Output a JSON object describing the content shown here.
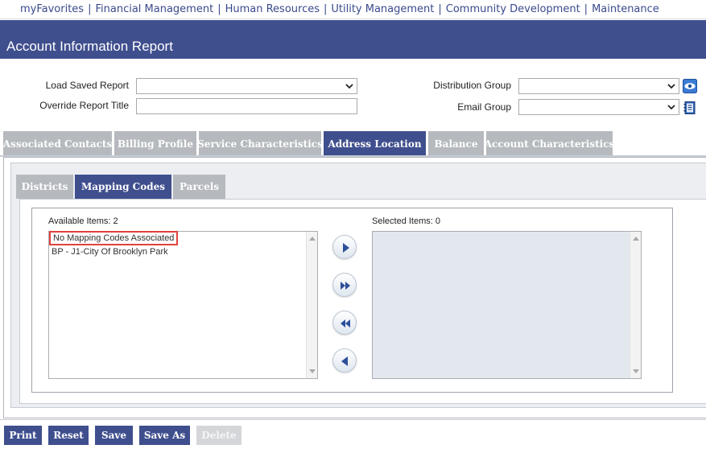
{
  "nav": {
    "items": [
      "myFavorites",
      "Financial Management",
      "Human Resources",
      "Utility Management",
      "Community Development",
      "Maintenance"
    ],
    "separator": "|"
  },
  "header": {
    "title": "Account Information Report"
  },
  "form": {
    "load_saved_report_label": "Load Saved Report",
    "load_saved_report_value": "",
    "override_title_label": "Override Report Title",
    "override_title_value": "",
    "distribution_group_label": "Distribution Group",
    "distribution_group_value": "",
    "email_group_label": "Email Group",
    "email_group_value": ""
  },
  "main_tabs": [
    "Associated Contacts",
    "Billing Profile",
    "Service Characteristics",
    "Address Location",
    "Balance",
    "Account Characteristics"
  ],
  "main_tab_active": "Address Location",
  "sub_tabs": [
    "Districts",
    "Mapping Codes",
    "Parcels"
  ],
  "sub_tab_active": "Mapping Codes",
  "picker": {
    "available_label": "Available Items: 2",
    "selected_label": "Selected Items: 0",
    "available_items": [
      "No Mapping Codes Associated",
      "BP - J1-City Of Brooklyn Park"
    ],
    "selected_items": []
  },
  "buttons": {
    "print": "Print",
    "reset": "Reset",
    "save": "Save",
    "save_as": "Save As",
    "delete": "Delete"
  },
  "colors": {
    "brand_blue": "#3f4f8e",
    "tab_gray": "#b6babe",
    "highlight_red": "#e0423d"
  },
  "icons": {
    "distribution_group": "eye-icon",
    "email_group": "address-book-icon"
  }
}
